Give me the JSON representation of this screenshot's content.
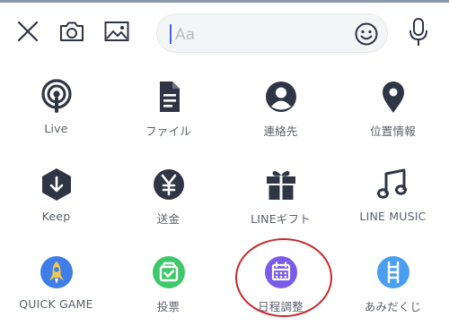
{
  "toolbar": {
    "close_icon": "close-icon",
    "camera_icon": "camera-icon",
    "image_icon": "image-icon",
    "input_placeholder": "Aa",
    "emoji_icon": "emoji-icon",
    "mic_icon": "mic-icon"
  },
  "menu": {
    "rows": [
      [
        {
          "label": "Live",
          "icon": "live-broadcast-icon"
        },
        {
          "label": "ファイル",
          "icon": "file-icon"
        },
        {
          "label": "連絡先",
          "icon": "contact-icon"
        },
        {
          "label": "位置情報",
          "icon": "location-pin-icon"
        }
      ],
      [
        {
          "label": "Keep",
          "icon": "keep-download-icon"
        },
        {
          "label": "送金",
          "icon": "yen-icon"
        },
        {
          "label": "LINEギフト",
          "icon": "gift-icon"
        },
        {
          "label": "LINE MUSIC",
          "icon": "music-note-icon"
        }
      ],
      [
        {
          "label": "QUICK GAME",
          "icon": "rocket-icon"
        },
        {
          "label": "投票",
          "icon": "vote-icon"
        },
        {
          "label": "日程調整",
          "icon": "calendar-icon"
        },
        {
          "label": "あみだくじ",
          "icon": "ladder-icon"
        }
      ]
    ]
  },
  "colors": {
    "icon_dark": "#2f3545",
    "quick_game": "#3f7ee8",
    "vote": "#3fc86a",
    "schedule": "#7b5ce8",
    "amida": "#4a9ef0",
    "highlight_circle": "#c9282d"
  }
}
